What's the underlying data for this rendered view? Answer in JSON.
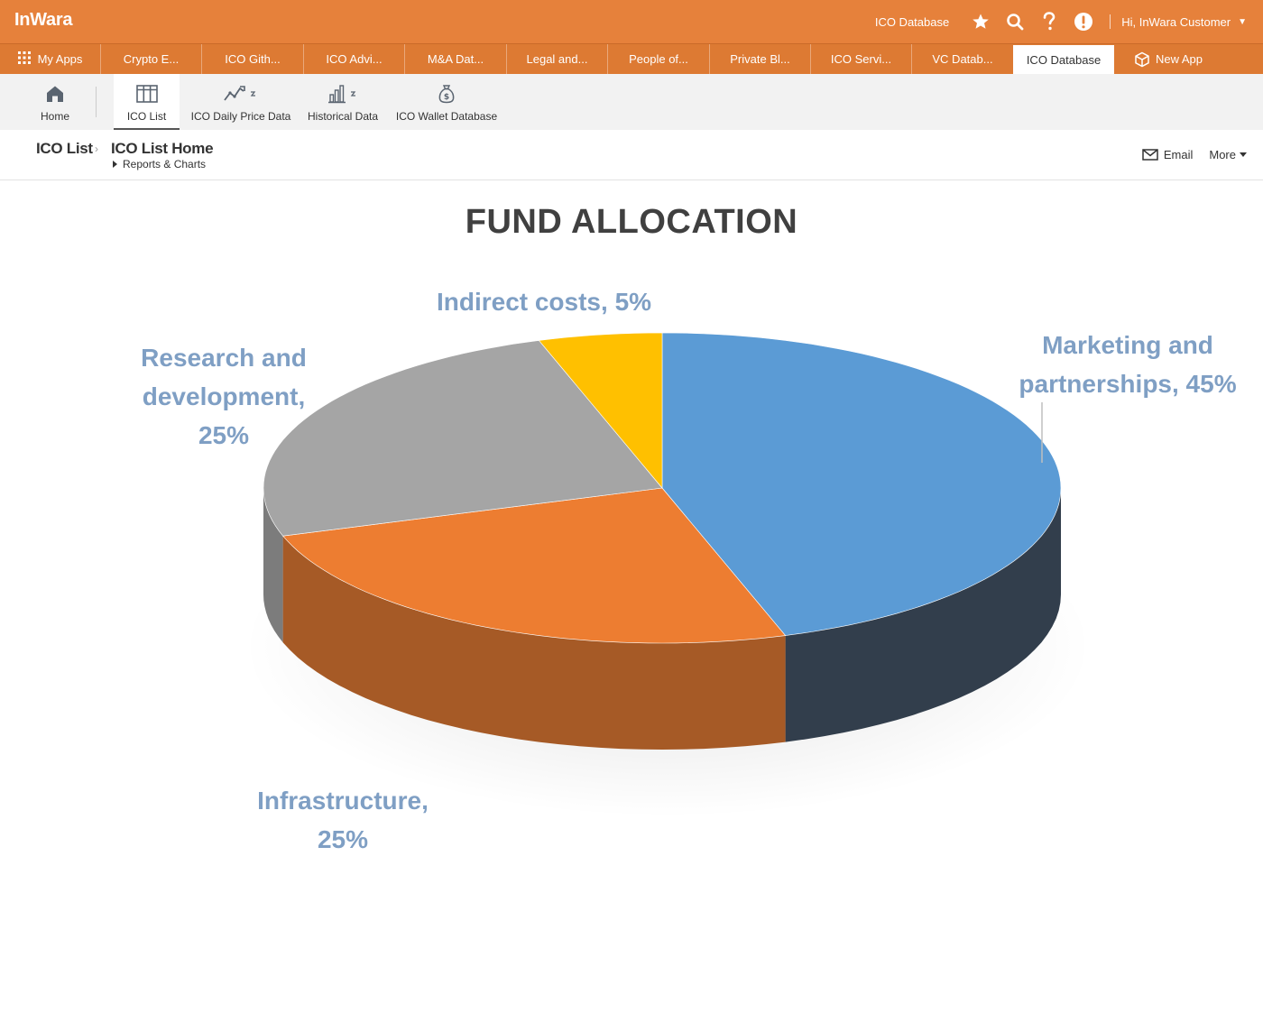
{
  "app": {
    "brand": "InWara",
    "header_db_label": "ICO Database",
    "greeting": "Hi, InWara Customer"
  },
  "app_tabs": [
    {
      "label": "My Apps",
      "icon": "grid-icon"
    },
    {
      "label": "Crypto E..."
    },
    {
      "label": "ICO Gith..."
    },
    {
      "label": "ICO Advi..."
    },
    {
      "label": "M&A Dat..."
    },
    {
      "label": "Legal and..."
    },
    {
      "label": "People of..."
    },
    {
      "label": "Private Bl..."
    },
    {
      "label": "ICO Servi..."
    },
    {
      "label": "VC Datab..."
    },
    {
      "label": "ICO Database"
    },
    {
      "label": "New App",
      "icon": "cube-icon"
    }
  ],
  "subnav": [
    {
      "label": "Home",
      "icon": "home-icon"
    },
    {
      "label": "ICO List",
      "icon": "list-icon"
    },
    {
      "label": "ICO Daily Price Data",
      "icon": "trend-chart-icon"
    },
    {
      "label": "Historical Data",
      "icon": "bar-chart-icon"
    },
    {
      "label": "ICO Wallet Database",
      "icon": "money-bag-icon"
    }
  ],
  "breadcrumb": {
    "root": "ICO List",
    "current": "ICO List Home",
    "sub": "Reports & Charts"
  },
  "actions": {
    "email": "Email",
    "more": "More"
  },
  "colors": {
    "header": "#e6813b",
    "tabbar": "#dd7a33",
    "marketing": "#5b9bd5",
    "infrastructure": "#ed7d31",
    "research": "#a5a5a5",
    "indirect": "#ffc000",
    "label_text": "#7f9fc4"
  },
  "chart_data": {
    "type": "pie",
    "title": "FUND ALLOCATION",
    "three_d": true,
    "categories": [
      "Marketing  and partnerships",
      "Infrastructure",
      "Research and development",
      "Indirect costs"
    ],
    "values": [
      45,
      25,
      25,
      5
    ],
    "unit": "%",
    "labels": [
      {
        "lines": [
          "Marketing  and",
          "partnerships,  45%"
        ]
      },
      {
        "lines": [
          "Infrastructure,",
          "25%"
        ]
      },
      {
        "lines": [
          "Research and",
          "development,",
          "25%"
        ]
      },
      {
        "lines": [
          "Indirect costs,  5%"
        ]
      }
    ]
  }
}
